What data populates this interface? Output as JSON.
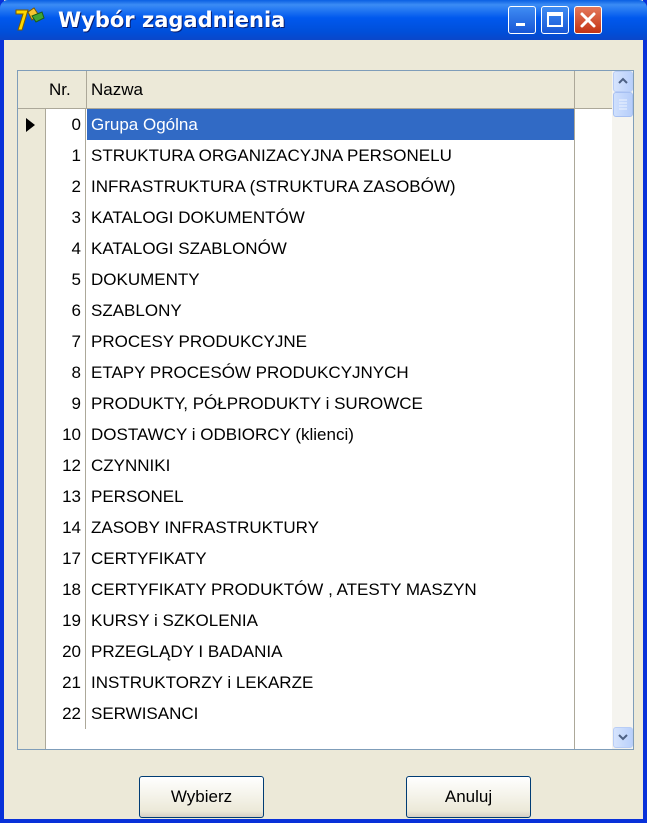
{
  "window": {
    "title": "Wybór zagadnienia"
  },
  "grid": {
    "columns": [
      "Nr.",
      "Nazwa"
    ],
    "selected_index": 0,
    "rows": [
      {
        "nr": "0",
        "name": "Grupa Ogólna"
      },
      {
        "nr": "1",
        "name": "STRUKTURA ORGANIZACYJNA PERSONELU"
      },
      {
        "nr": "2",
        "name": "INFRASTRUKTURA (STRUKTURA ZASOBÓW)"
      },
      {
        "nr": "3",
        "name": "KATALOGI DOKUMENTÓW"
      },
      {
        "nr": "4",
        "name": "KATALOGI SZABLONÓW"
      },
      {
        "nr": "5",
        "name": "DOKUMENTY"
      },
      {
        "nr": "6",
        "name": "SZABLONY"
      },
      {
        "nr": "7",
        "name": "PROCESY PRODUKCYJNE"
      },
      {
        "nr": "8",
        "name": "ETAPY PROCESÓW PRODUKCYJNYCH"
      },
      {
        "nr": "9",
        "name": "PRODUKTY, PÓŁPRODUKTY i SUROWCE"
      },
      {
        "nr": "10",
        "name": "DOSTAWCY i ODBIORCY (klienci)"
      },
      {
        "nr": "12",
        "name": "CZYNNIKI"
      },
      {
        "nr": "13",
        "name": "PERSONEL"
      },
      {
        "nr": "14",
        "name": "ZASOBY INFRASTRUKTURY"
      },
      {
        "nr": "17",
        "name": "CERTYFIKATY"
      },
      {
        "nr": "18",
        "name": "CERTYFIKATY PRODUKTÓW , ATESTY MASZYN"
      },
      {
        "nr": "19",
        "name": "KURSY i SZKOLENIA"
      },
      {
        "nr": "20",
        "name": "PRZEGLĄDY I BADANIA"
      },
      {
        "nr": "21",
        "name": "INSTRUKTORZY i LEKARZE"
      },
      {
        "nr": "22",
        "name": "SERWISANCI"
      }
    ]
  },
  "buttons": {
    "select_label": "Wybierz",
    "cancel_label": "Anuluj"
  },
  "colors": {
    "selection": "#316ac5",
    "titlebar": "#0058ee"
  },
  "icons": [
    "app-icon",
    "minimize-icon",
    "maximize-icon",
    "close-icon",
    "row-indicator-icon",
    "scroll-up-icon",
    "scroll-down-icon"
  ]
}
